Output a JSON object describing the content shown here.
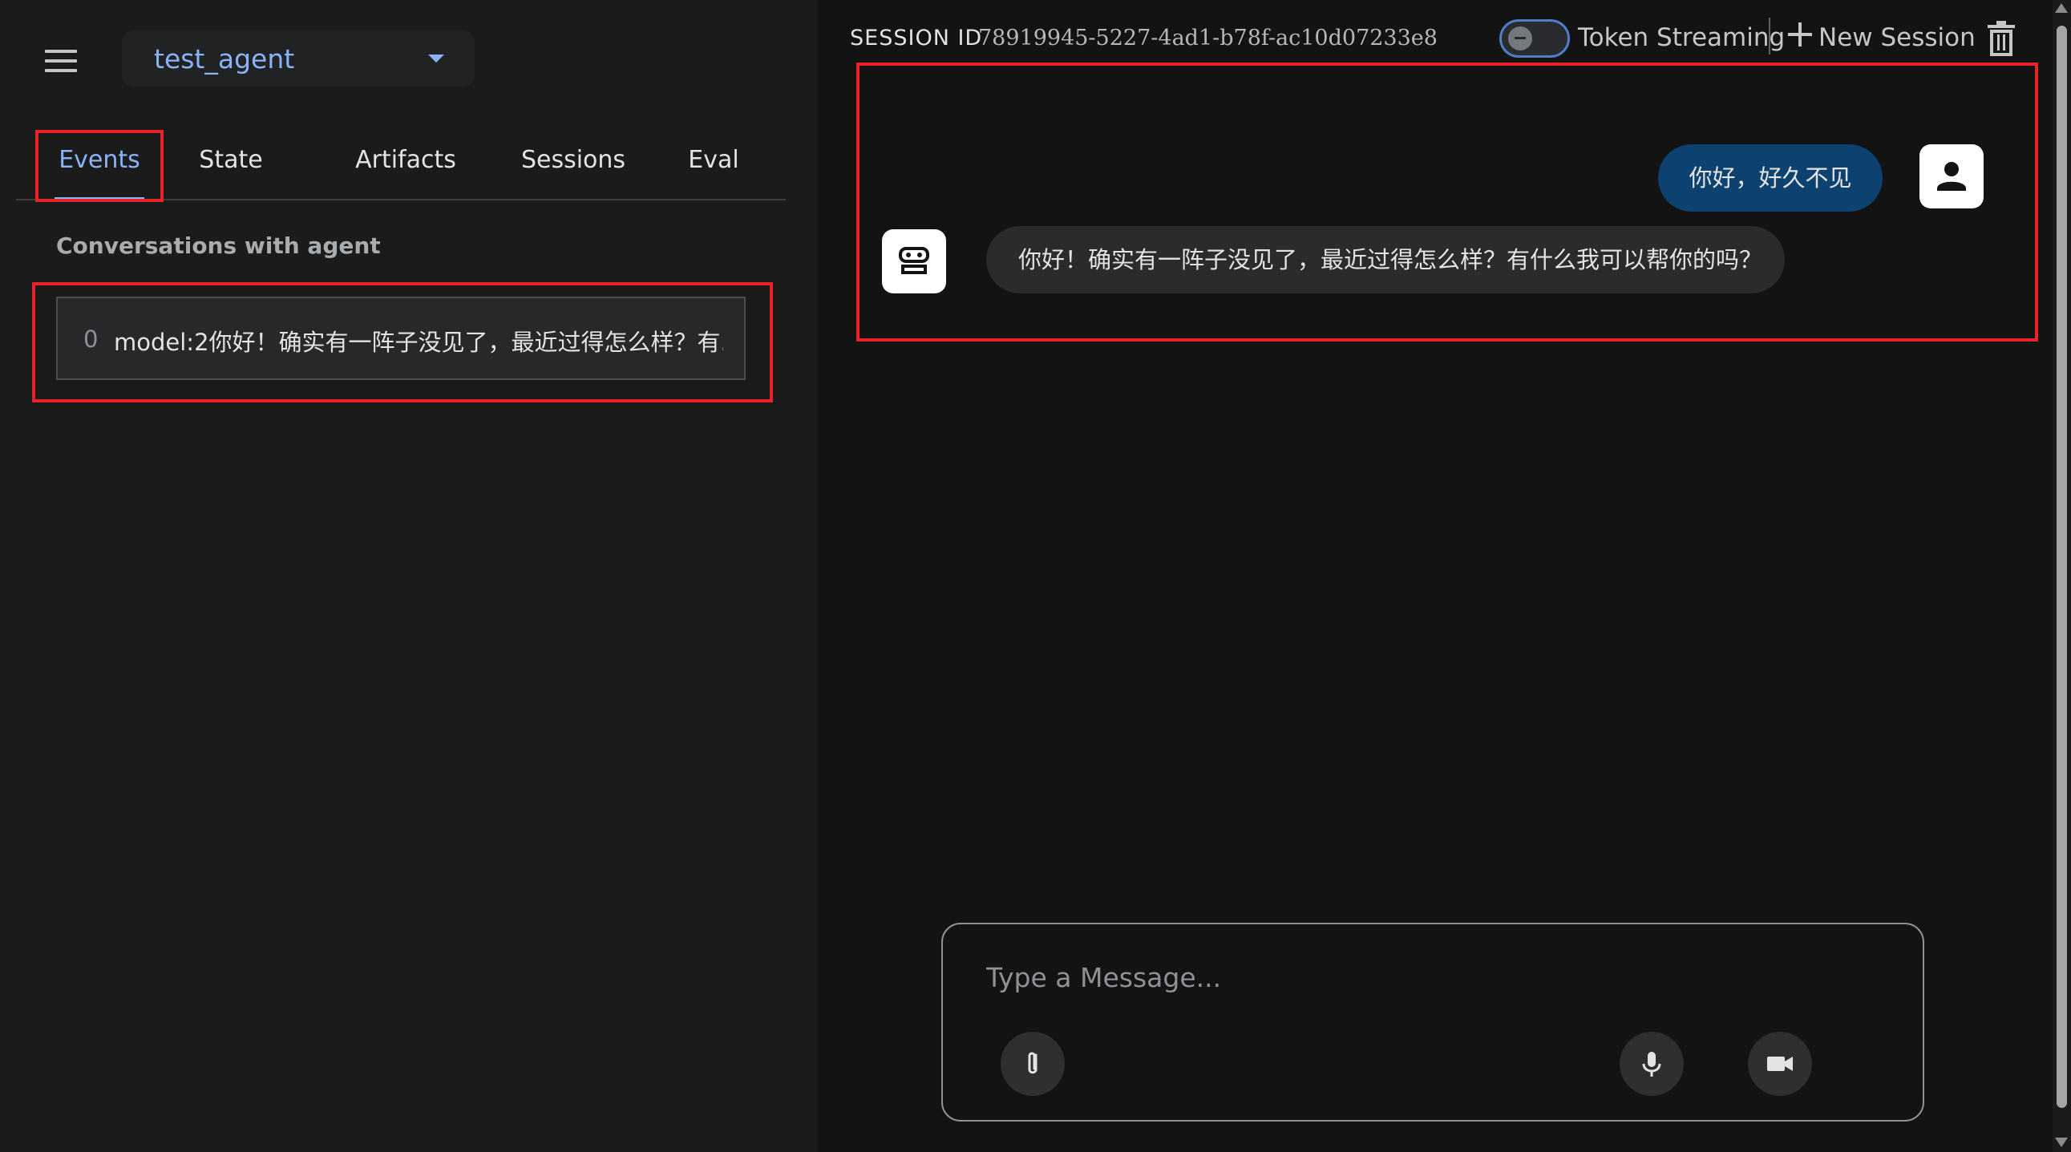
{
  "sidebar": {
    "agent_name": "test_agent",
    "tabs": [
      {
        "label": "Events"
      },
      {
        "label": "State"
      },
      {
        "label": "Artifacts"
      },
      {
        "label": "Sessions"
      },
      {
        "label": "Eval"
      }
    ],
    "active_tab": "Events",
    "section_title": "Conversations with agent",
    "events": [
      {
        "index": "0",
        "text": "model:2你好！确实有一阵子没见了，最近过得怎么样？有..."
      }
    ]
  },
  "header": {
    "session_label": "SESSION ID",
    "session_id": "78919945-5227-4ad1-b78f-ac10d07233e8",
    "token_streaming_label": "Token Streaming",
    "token_streaming_on": false,
    "new_session_label": "New Session"
  },
  "chat": {
    "messages": [
      {
        "role": "user",
        "text": "你好，好久不见"
      },
      {
        "role": "model",
        "text": "你好！确实有一阵子没见了，最近过得怎么样？有什么我可以帮你的吗？"
      }
    ]
  },
  "composer": {
    "placeholder": "Type a Message..."
  },
  "colors": {
    "accent": "#8ab4f8",
    "user_bubble": "#0d4270",
    "highlight_box": "#e8242a",
    "background": "#131314",
    "sidebar_bg": "#1b1b1c"
  },
  "icons": [
    "menu-icon",
    "chevron-down-icon",
    "plus-icon",
    "trash-icon",
    "person-icon",
    "robot-icon",
    "paperclip-icon",
    "microphone-icon",
    "videocam-icon"
  ]
}
